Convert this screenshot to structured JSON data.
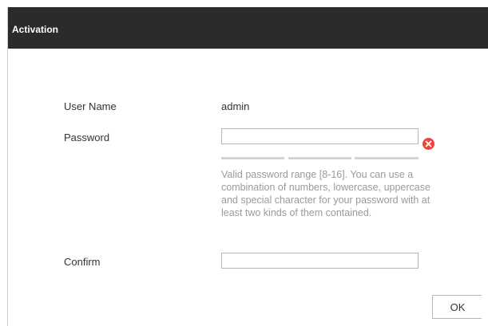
{
  "dialog": {
    "title": "Activation"
  },
  "form": {
    "username_label": "User Name",
    "username_value": "admin",
    "password_label": "Password",
    "password_value": "",
    "password_hint": "Valid password range [8-16]. You can use a combination of numbers, lowercase, uppercase and special character for your password with at least two kinds of them contained.",
    "confirm_label": "Confirm",
    "confirm_value": ""
  },
  "icons": {
    "password_error": "error-x-icon"
  },
  "colors": {
    "titlebar": "#2b2b2b",
    "error": "#e8453c",
    "hint_text": "#9a9a9a"
  },
  "actions": {
    "ok_label": "OK"
  }
}
